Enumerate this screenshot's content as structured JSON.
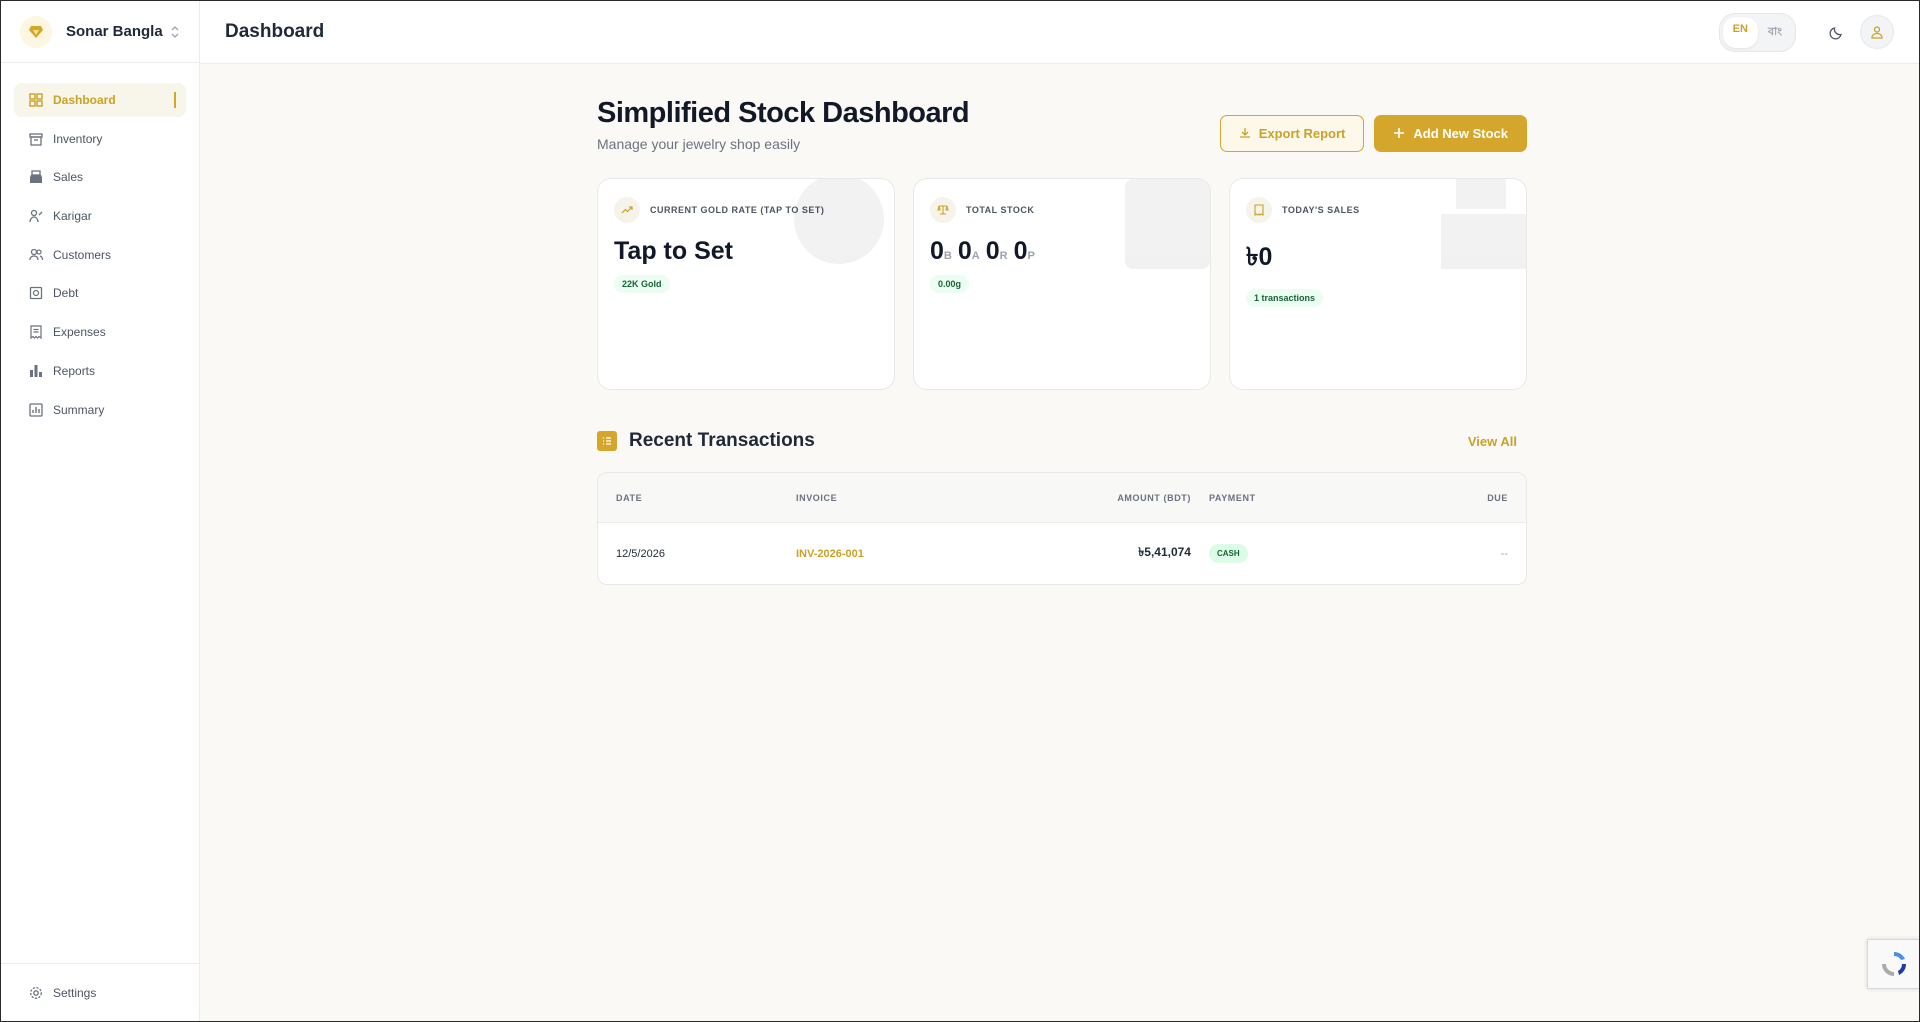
{
  "brand": {
    "name": "Sonar Bangla",
    "logo_icon": "gem-icon"
  },
  "sidebar": {
    "items": [
      {
        "label": "Dashboard",
        "icon": "grid-icon",
        "active": true
      },
      {
        "label": "Inventory",
        "icon": "archive-icon"
      },
      {
        "label": "Sales",
        "icon": "register-icon"
      },
      {
        "label": "Karigar",
        "icon": "worker-icon"
      },
      {
        "label": "Customers",
        "icon": "users-icon"
      },
      {
        "label": "Debt",
        "icon": "wallet-icon"
      },
      {
        "label": "Expenses",
        "icon": "receipt-icon"
      },
      {
        "label": "Reports",
        "icon": "bar-chart-icon"
      },
      {
        "label": "Summary",
        "icon": "summary-chart-icon"
      }
    ],
    "settings_label": "Settings"
  },
  "topbar": {
    "title": "Dashboard",
    "lang_en": "EN",
    "lang_bn": "বাং"
  },
  "main": {
    "heading": "Simplified Stock Dashboard",
    "subtitle": "Manage your jewelry shop easily",
    "export_label": "Export Report",
    "add_label": "Add New Stock"
  },
  "cards": {
    "gold_rate": {
      "label": "CURRENT GOLD RATE (TAP TO SET)",
      "value": "Tap to Set",
      "pill": "22K Gold"
    },
    "total_stock": {
      "label": "TOTAL STOCK",
      "parts": [
        {
          "num": "0",
          "unit": "B"
        },
        {
          "num": "0",
          "unit": "A"
        },
        {
          "num": "0",
          "unit": "R"
        },
        {
          "num": "0",
          "unit": "P"
        }
      ],
      "pill": "0.00g"
    },
    "today_sales": {
      "label": "TODAY'S SALES",
      "value": "৳0",
      "pill": "1 transactions"
    }
  },
  "transactions": {
    "title": "Recent Transactions",
    "view_all": "View All",
    "columns": [
      "DATE",
      "INVOICE",
      "AMOUNT (BDT)",
      "PAYMENT",
      "DUE"
    ],
    "rows": [
      {
        "date": "12/5/2026",
        "invoice": "INV-2026-001",
        "amount": "৳5,41,074",
        "payment": "CASH",
        "due": "--"
      }
    ]
  },
  "colors": {
    "accent": "#d4a72c",
    "success_bg": "#dcfce7",
    "success_text": "#166534"
  }
}
